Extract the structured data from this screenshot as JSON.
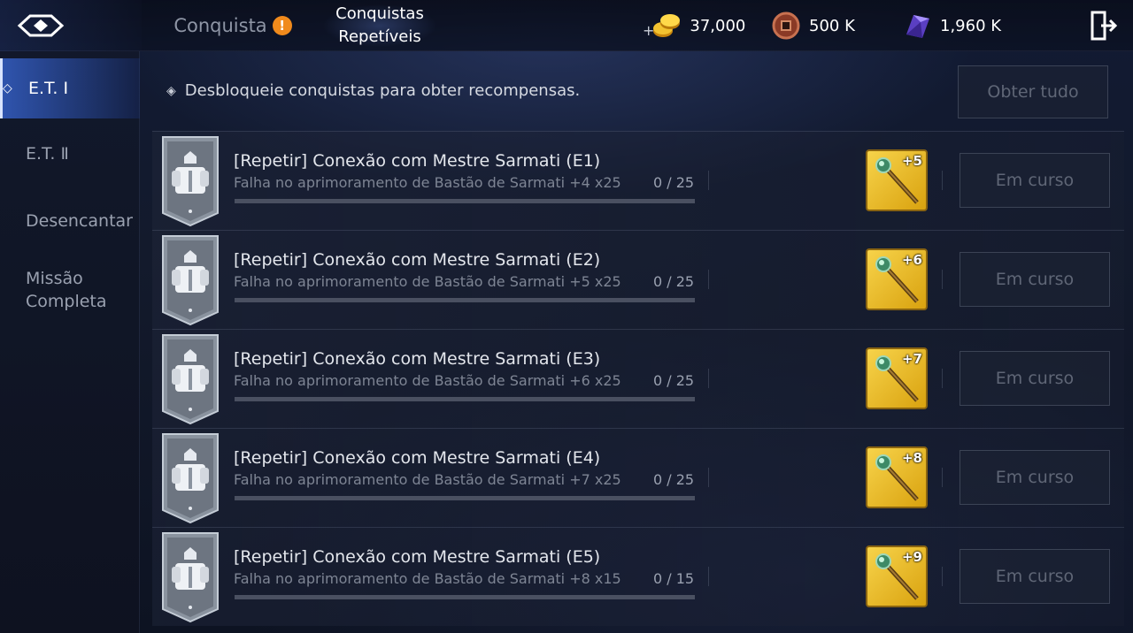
{
  "topbar": {
    "tabs": [
      {
        "label": "Conquista",
        "alert": "!"
      },
      {
        "label_line1": "Conquistas",
        "label_line2": "Repetíveis"
      }
    ],
    "currencies": [
      {
        "name": "gold",
        "plus": "+",
        "value": "37,000",
        "icon": "gold-coins-icon"
      },
      {
        "name": "coin",
        "value": "500 K",
        "icon": "bronze-coin-icon"
      },
      {
        "name": "crystal",
        "value": "1,960 K",
        "icon": "purple-crystal-icon"
      }
    ]
  },
  "sidebar": {
    "items": [
      {
        "label": "E.T. Ⅰ",
        "active": true
      },
      {
        "label": "E.T. Ⅱ",
        "active": false
      },
      {
        "label": "Desencantar",
        "active": false
      },
      {
        "label_line1": "Missão",
        "label_line2": "Completa",
        "active": false
      }
    ]
  },
  "main": {
    "hint": "Desbloqueie conquistas para obter recompensas.",
    "claim_all_label": "Obter tudo",
    "rows": [
      {
        "title": "[Repetir] Conexão com Mestre Sarmati (E1)",
        "subtitle": "Falha no aprimoramento de Bastão de Sarmati +4 x25",
        "count": "0 / 25",
        "progress": 0,
        "reward_level": "+5",
        "status": "Em curso"
      },
      {
        "title": "[Repetir] Conexão com Mestre Sarmati (E2)",
        "subtitle": "Falha no aprimoramento de Bastão de Sarmati +5 x25",
        "count": "0 / 25",
        "progress": 0,
        "reward_level": "+6",
        "status": "Em curso"
      },
      {
        "title": "[Repetir] Conexão com Mestre Sarmati (E3)",
        "subtitle": "Falha no aprimoramento de Bastão de Sarmati +6 x25",
        "count": "0 / 25",
        "progress": 0,
        "reward_level": "+7",
        "status": "Em curso"
      },
      {
        "title": "[Repetir] Conexão com Mestre Sarmati (E4)",
        "subtitle": "Falha no aprimoramento de Bastão de Sarmati +7 x25",
        "count": "0 / 25",
        "progress": 0,
        "reward_level": "+8",
        "status": "Em curso"
      },
      {
        "title": "[Repetir] Conexão com Mestre Sarmati (E5)",
        "subtitle": "Falha no aprimoramento de Bastão de Sarmati +8 x15",
        "count": "0 / 15",
        "progress": 0,
        "reward_level": "+9",
        "status": "Em curso"
      }
    ]
  },
  "colors": {
    "accent": "#3c6ee6",
    "alert": "#f08a1c",
    "reward_bg": "#f7d34a"
  }
}
